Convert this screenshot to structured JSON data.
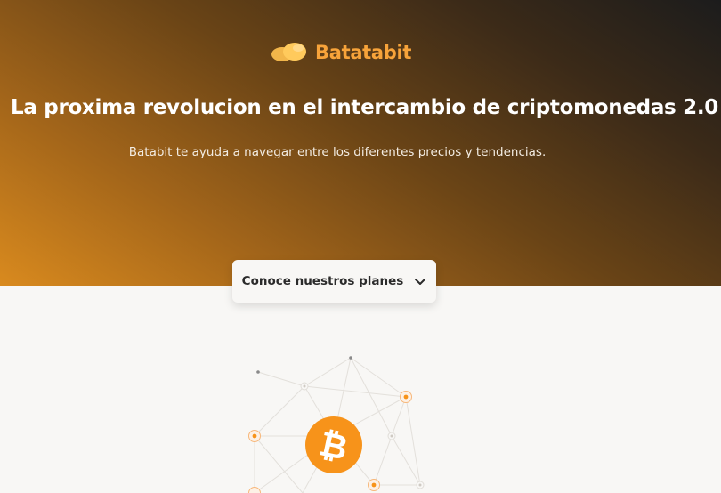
{
  "header": {
    "brand_name": "Batatabit",
    "logo_icon": "potato-logo-icon",
    "title": "La proxima revolucion en el intercambio de criptomonedas 2.0",
    "subtitle": "Batabit te ayuda a navegar entre los diferentes precios y tendencias."
  },
  "cta": {
    "label": "Conoce nuestros planes",
    "icon": "chevron-down-icon"
  },
  "illustration": {
    "icon": "bitcoin-icon",
    "symbol": "₿"
  },
  "colors": {
    "accent": "#f7a33a",
    "bitcoin_orange": "#f7931a",
    "hero_dark": "#1c1c1c",
    "hero_light": "#d98a1e",
    "background": "#f8f7f5"
  }
}
